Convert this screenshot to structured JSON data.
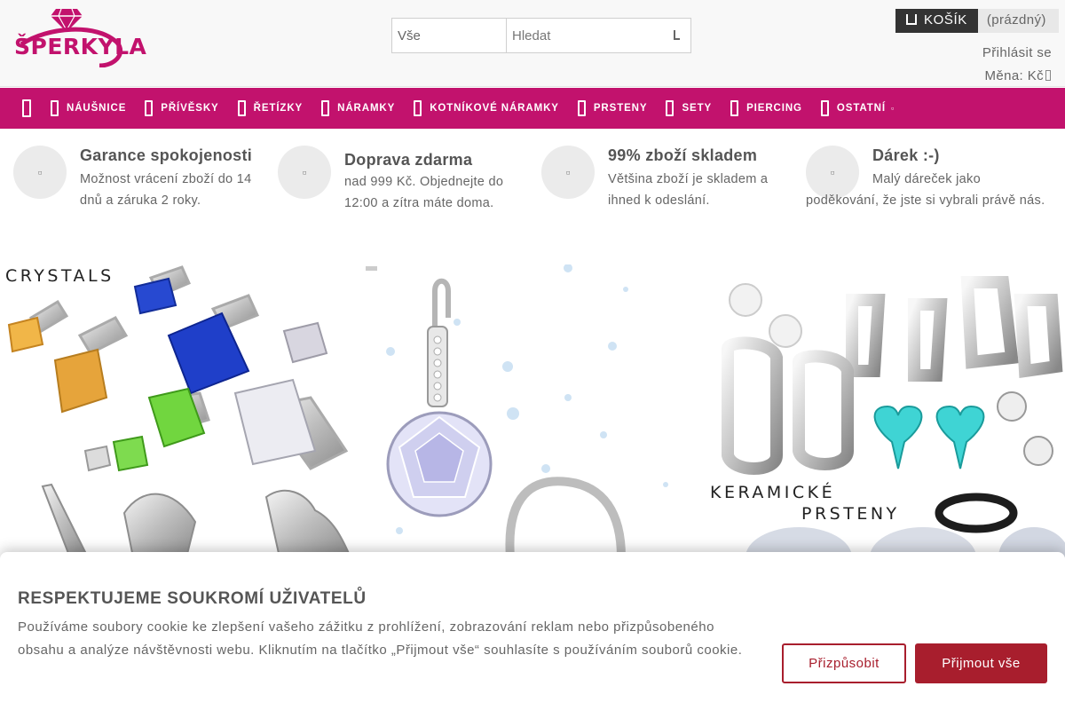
{
  "header": {
    "logo_text": "ŠPERKYLA",
    "search": {
      "category": "Vše",
      "placeholder": "Hledat"
    },
    "cart": {
      "label": "KOŠÍK",
      "status": "(prázdný)"
    },
    "login": "Přihlásit se",
    "currency": "Měna: Kč"
  },
  "nav": {
    "items": [
      {
        "label": "NÁUŠNICE"
      },
      {
        "label": "PŘÍVĚSKY"
      },
      {
        "label": "ŘETÍZKY"
      },
      {
        "label": "NÁRAMKY"
      },
      {
        "label": "KOTNÍKOVÉ NÁRAMKY"
      },
      {
        "label": "PRSTENY"
      },
      {
        "label": "SETY"
      },
      {
        "label": "PIERCING"
      },
      {
        "label": "OSTATNÍ"
      }
    ]
  },
  "benefits": [
    {
      "title": "Garance spokojenosti",
      "text": "Možnost vrácení zboží do 14 dnů a záruka 2 roky."
    },
    {
      "title": "Doprava zdarma",
      "text": "nad 999 Kč. Objednejte do 12:00 a zítra máte doma."
    },
    {
      "title": "99% zboží skladem",
      "text": "Většina zboží je skladem a ihned k odeslání."
    },
    {
      "title": "Dárek :-)",
      "text": "Malý dáreček jako poděkování, že jste si vybrali právě nás."
    }
  ],
  "banners": {
    "left_label": "CRYSTALS",
    "right_label_1": "KERAMICKÉ",
    "right_label_2": "PRSTENY"
  },
  "cookie": {
    "title": "RESPEKTUJEME SOUKROMÍ UŽIVATELŮ",
    "text": "Používáme soubory cookie ke zlepšení vašeho zážitku z prohlížení, zobrazování reklam nebo přizpůsobeného obsahu a analýze návštěvnosti webu. Kliknutím na tlačítko „Přijmout vše“ souhlasíte s používáním souborů cookie.",
    "customize_label": "Přizpůsobit",
    "accept_label": "Přijmout vše"
  },
  "colors": {
    "brand": "#c2126d",
    "accept": "#a81e2d"
  }
}
